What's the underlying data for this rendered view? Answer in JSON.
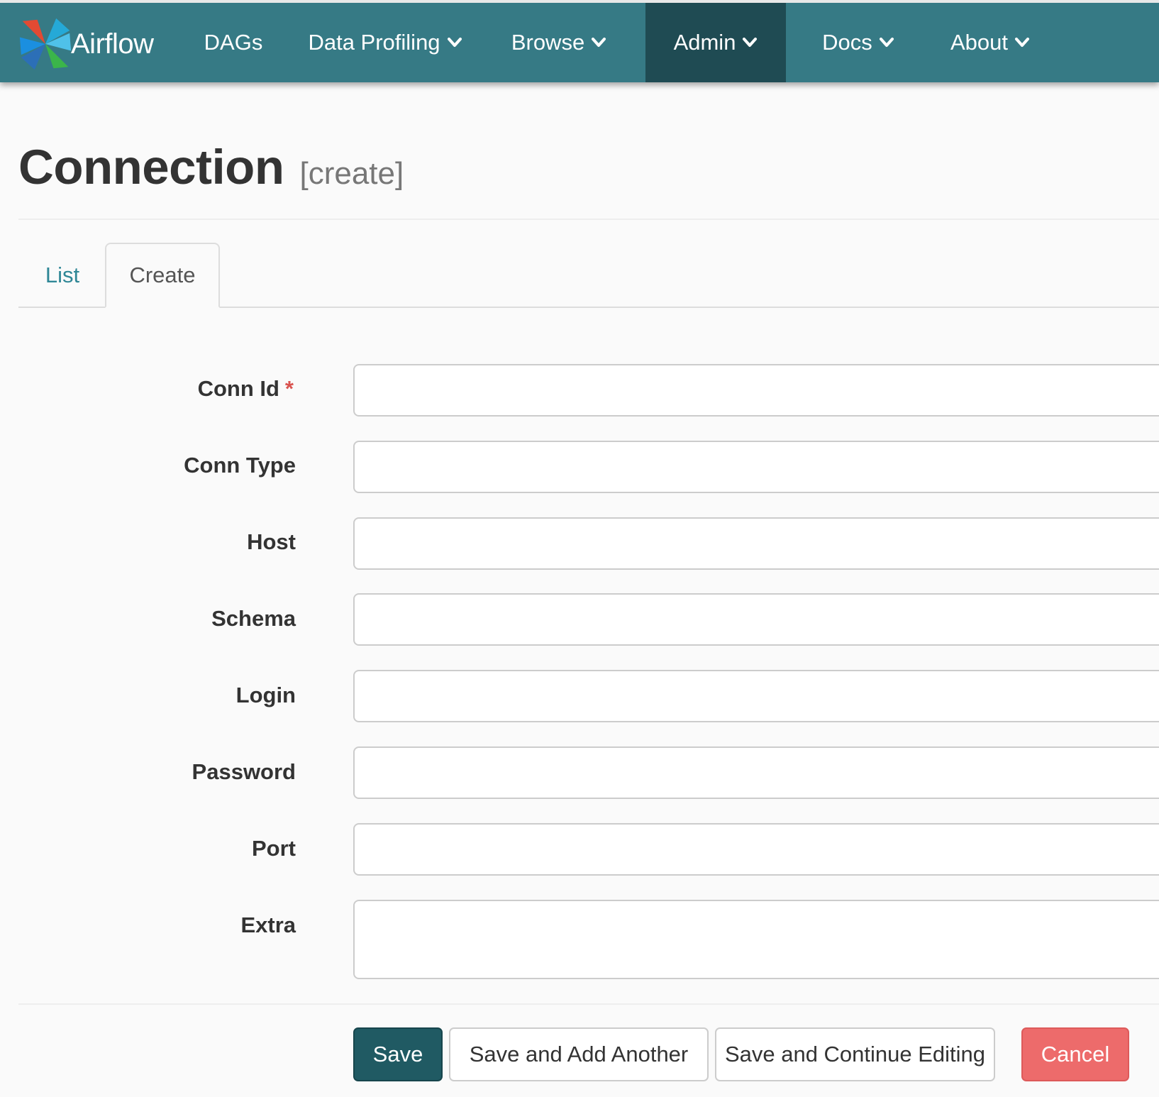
{
  "navbar": {
    "brand_label": "Airflow",
    "items": [
      {
        "label": "DAGs",
        "dropdown": false
      },
      {
        "label": "Data Profiling",
        "dropdown": true
      },
      {
        "label": "Browse",
        "dropdown": true
      },
      {
        "label": "Admin",
        "dropdown": true,
        "active": true
      },
      {
        "label": "Docs",
        "dropdown": true
      },
      {
        "label": "About",
        "dropdown": true
      }
    ]
  },
  "header": {
    "title": "Connection",
    "subtitle": "[create]"
  },
  "tabs": [
    {
      "label": "List",
      "active": false
    },
    {
      "label": "Create",
      "active": true
    }
  ],
  "form": {
    "fields": [
      {
        "label": "Conn Id",
        "required": true,
        "value": ""
      },
      {
        "label": "Conn Type",
        "required": false,
        "value": ""
      },
      {
        "label": "Host",
        "required": false,
        "value": ""
      },
      {
        "label": "Schema",
        "required": false,
        "value": ""
      },
      {
        "label": "Login",
        "required": false,
        "value": ""
      },
      {
        "label": "Password",
        "required": false,
        "value": ""
      },
      {
        "label": "Port",
        "required": false,
        "value": ""
      },
      {
        "label": "Extra",
        "required": false,
        "value": ""
      }
    ],
    "required_marker": "*"
  },
  "actions": {
    "save": "Save",
    "save_add_another": "Save and Add Another",
    "save_continue": "Save and Continue Editing",
    "cancel": "Cancel"
  },
  "colors": {
    "navbar": "#367a85",
    "navbar_active": "#1f4b53",
    "link": "#2f8796",
    "primary_button": "#205a63",
    "danger_button": "#ed6b6b",
    "required": "#d9534f"
  },
  "icons": {
    "brand": "airflow-pinwheel-logo",
    "dropdown": "chevron-down"
  }
}
